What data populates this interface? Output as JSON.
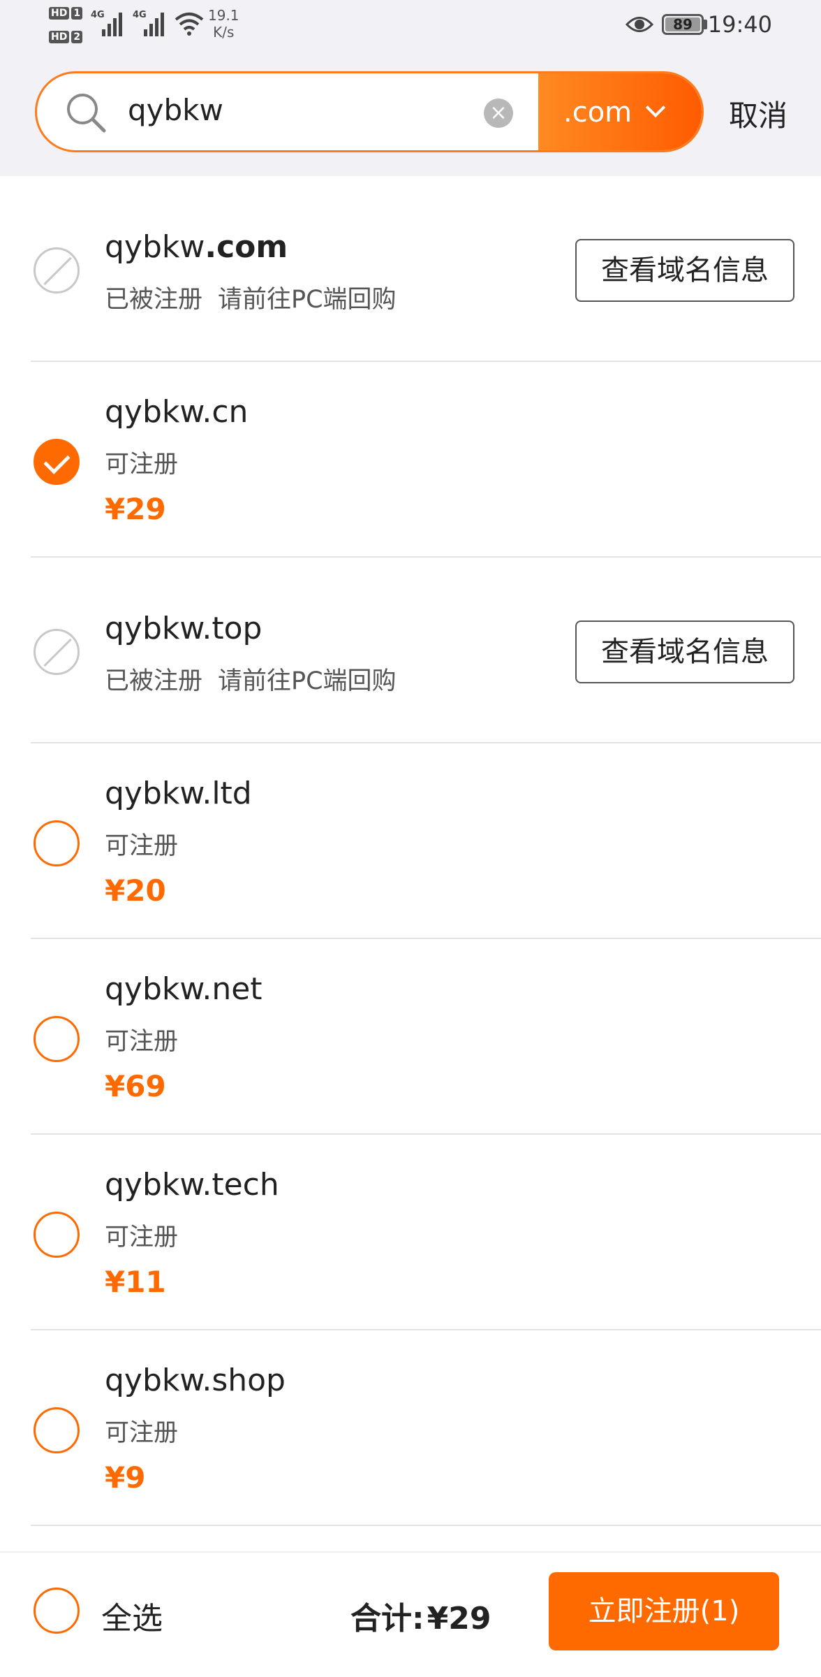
{
  "status_bar": {
    "hd1": "HD",
    "hd1_num": "1",
    "hd2": "HD",
    "hd2_num": "2",
    "net1": "4G",
    "net2": "4G",
    "speed_value": "19.1",
    "speed_unit": "K/s",
    "battery": "89",
    "time": "19:40"
  },
  "search": {
    "query": "qybkw",
    "tld": ".com",
    "cancel_label": "取消"
  },
  "results": [
    {
      "name": "qybkw",
      "tld": ".com",
      "tld_bold": true,
      "status": "已被注册",
      "note": "请前往PC端回购",
      "price": "",
      "state": "taken",
      "button": "查看域名信息"
    },
    {
      "name": "qybkw",
      "tld": ".cn",
      "tld_bold": false,
      "status": "可注册",
      "note": "",
      "price": "¥29",
      "state": "checked",
      "button": ""
    },
    {
      "name": "qybkw",
      "tld": ".top",
      "tld_bold": false,
      "status": "已被注册",
      "note": "请前往PC端回购",
      "price": "",
      "state": "taken",
      "button": "查看域名信息"
    },
    {
      "name": "qybkw",
      "tld": ".ltd",
      "tld_bold": false,
      "status": "可注册",
      "note": "",
      "price": "¥20",
      "state": "unchecked",
      "button": ""
    },
    {
      "name": "qybkw",
      "tld": ".net",
      "tld_bold": false,
      "status": "可注册",
      "note": "",
      "price": "¥69",
      "state": "unchecked",
      "button": ""
    },
    {
      "name": "qybkw",
      "tld": ".tech",
      "tld_bold": false,
      "status": "可注册",
      "note": "",
      "price": "¥11",
      "state": "unchecked",
      "button": ""
    },
    {
      "name": "qybkw",
      "tld": ".shop",
      "tld_bold": false,
      "status": "可注册",
      "note": "",
      "price": "¥9",
      "state": "unchecked",
      "button": ""
    }
  ],
  "footer": {
    "select_all": "全选",
    "total_label": "合计:",
    "total_amount": "¥29",
    "register_label": "立即注册(1)"
  },
  "colors": {
    "accent": "#ff6a00",
    "header_bg": "#f2f2f6",
    "disabled": "#c8c8c8"
  }
}
